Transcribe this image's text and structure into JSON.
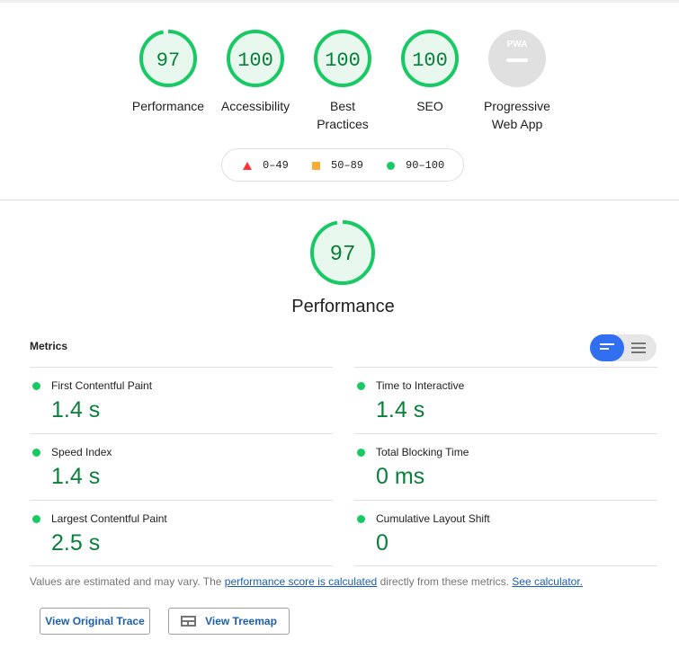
{
  "categories": [
    {
      "id": "performance",
      "score": "97",
      "label": "Performance",
      "fraction": 0.97
    },
    {
      "id": "accessibility",
      "score": "100",
      "label": "Accessibility",
      "fraction": 1.0
    },
    {
      "id": "best-practices",
      "score": "100",
      "label": "Best Practices",
      "fraction": 1.0
    },
    {
      "id": "seo",
      "score": "100",
      "label": "SEO",
      "fraction": 1.0
    },
    {
      "id": "pwa",
      "badge": "PWA",
      "label": "Progressive Web App"
    }
  ],
  "legend": {
    "fail": "0–49",
    "average": "50–89",
    "pass": "90–100"
  },
  "performance": {
    "score": "97",
    "title": "Performance",
    "fraction": 0.97
  },
  "metrics": {
    "heading": "Metrics",
    "items": [
      {
        "name": "First Contentful Paint",
        "value": "1.4 s"
      },
      {
        "name": "Time to Interactive",
        "value": "1.4 s"
      },
      {
        "name": "Speed Index",
        "value": "1.4 s"
      },
      {
        "name": "Total Blocking Time",
        "value": "0 ms"
      },
      {
        "name": "Largest Contentful Paint",
        "value": "2.5 s"
      },
      {
        "name": "Cumulative Layout Shift",
        "value": "0"
      }
    ]
  },
  "note": {
    "text1": "Values are estimated and may vary. The",
    "link1": "performance score is calculated",
    "text2": "directly from these metrics.",
    "link2": "See calculator."
  },
  "buttons": {
    "trace": "View Original Trace",
    "treemap": "View Treemap"
  },
  "colors": {
    "pass": "#18c964",
    "pass_text": "#0a7f3a",
    "average": "#ffaa33",
    "fail": "#ff3333",
    "link": "#1a5fb4",
    "toggle_active": "#2f6ff0"
  }
}
